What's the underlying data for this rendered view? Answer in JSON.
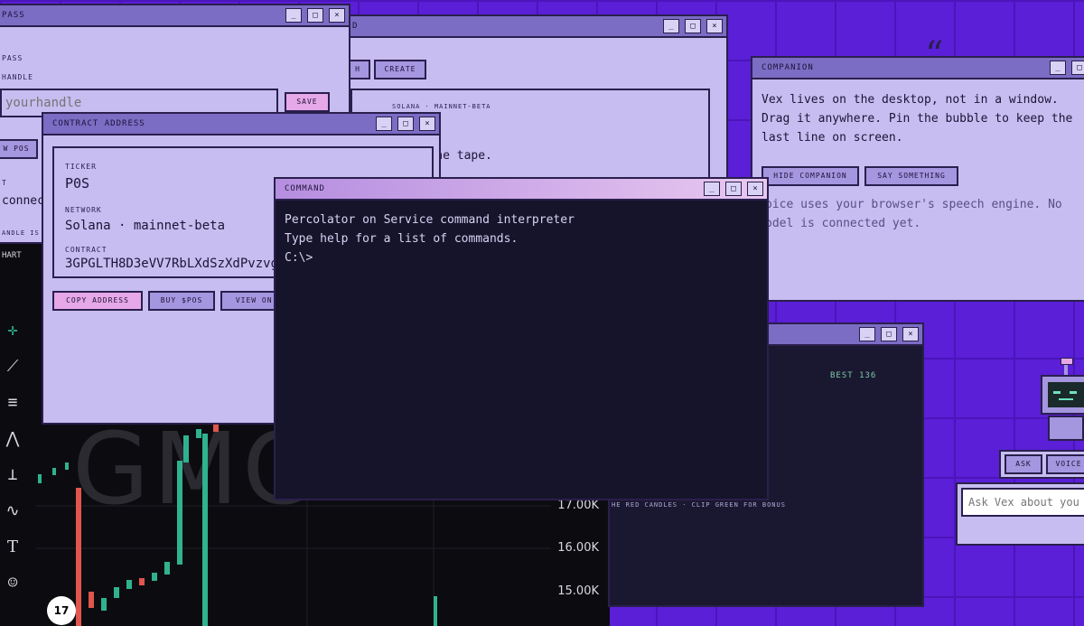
{
  "pass_window": {
    "title": "Pass",
    "handle_label": "Handle",
    "handle_placeholder": "yourhandle",
    "save_label": "Save",
    "view_pos_label": "w POS",
    "status_label": "T",
    "status_text": "connec",
    "handle_note": "ANDLE IS S"
  },
  "back_window": {
    "title": "D",
    "btn_left": "H",
    "create_label": "Create",
    "network_line": "Solana · mainnet-beta",
    "tape_text": "sk reads the tape."
  },
  "contract_window": {
    "title": "Contract Address",
    "ticker_label": "Ticker",
    "ticker_value": "P0S",
    "network_label": "Network",
    "network_value": "Solana · mainnet-beta",
    "contract_label": "Contract",
    "contract_value": "3GPGLTH8D3eVV7RbLXdSzXdPvzvgJ",
    "copy_label": "Copy Address",
    "buy_label": "Buy $POS",
    "view_label": "View on E"
  },
  "command_window": {
    "title": "Command",
    "line1": "Percolator on Service command interpreter",
    "line2": "Type help for a list of commands.",
    "prompt": "C:\\>"
  },
  "companion_window": {
    "title": "Companion",
    "desc_line1": "Vex lives on the desktop, not in a window.",
    "desc_line2": "Drag it anywhere. Pin the bubble to keep the",
    "desc_line3": "last line on screen.",
    "hide_label": "Hide Companion",
    "say_label": "Say Something",
    "voice_line1": "oice uses your browser's speech engine. No",
    "voice_line2": "odel is connected yet."
  },
  "chart": {
    "label": "HART",
    "watermark": "GMC",
    "prices": [
      "17.00K",
      "16.00K",
      "15.00K"
    ],
    "logo": "17"
  },
  "game_window": {
    "best": "BEST 136",
    "hint": "HE RED CANDLES · CLIP GREEN FOR BONUS"
  },
  "vex": {
    "ask_label": "Ask",
    "voice_label": "Voice",
    "input_placeholder": "Ask Vex about you"
  },
  "desktop_glyph": "“"
}
